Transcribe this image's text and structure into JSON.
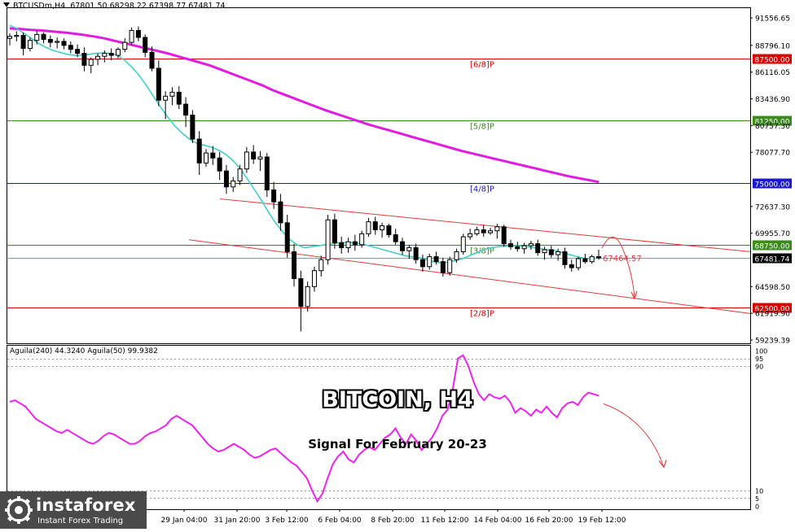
{
  "header": {
    "symbol": "BTCUSDm,H4",
    "ohlc": "67801.50 68298.22 67398.77 67481.74",
    "indicator": "Aguila(240) 44.3240  Aguila(50) 99.9382"
  },
  "overlay": {
    "title": "BITCOIN, H4",
    "subtitle": "Signal For February 20-23",
    "logo_brand": "instaforex",
    "logo_tagline": "Instant Forex Trading",
    "logo_icon": "gear-globe-icon"
  },
  "colors": {
    "candle": "#000000",
    "ma_fast": "#40d0c8",
    "ma_slow": "#e21be2",
    "murrey_red": "#dd0000",
    "murrey_green": "#3a8a1e",
    "murrey_blue": "#1a1acc",
    "channel": "#e33b3b",
    "oscillator": "#ee22ee",
    "price_line": "#7aa0a0"
  },
  "chart_data": [
    {
      "type": "line",
      "kind": "candlestick",
      "timeframe": "H4",
      "ylim": [
        59239.39,
        91556.65
      ],
      "y_ticks": [
        "91556.65",
        "88796.10",
        "86116.05",
        "83436.90",
        "80757.30",
        "78077.70",
        "75000.00",
        "72637.30",
        "69955.70",
        "68750.00",
        "67481.74",
        "64598.50",
        "61919.90",
        "59239.39"
      ],
      "x_ticks": [
        "29 Jan 04:00",
        "31 Jan 20:00",
        "3 Feb 12:00",
        "6 Feb 04:00",
        "8 Feb 20:00",
        "11 Feb 12:00",
        "14 Feb 04:00",
        "16 Feb 20:00",
        "19 Feb 12:00"
      ],
      "current_price": 67481.74,
      "target_label": "67464.57",
      "murrey_levels": [
        {
          "label": "[6/8]P",
          "price": 87500.0,
          "tag": "87500.00",
          "color": "#dd0000"
        },
        {
          "label": "[5/8]P",
          "price": 81250.0,
          "tag": "81250.00",
          "color": "#3a8a1e"
        },
        {
          "label": "[4/8]P",
          "price": 75000.0,
          "tag": "75000.00",
          "color": "#1a1acc"
        },
        {
          "label": "[3/8]P",
          "price": 68750.0,
          "tag": "68750.00",
          "color": "#3a8a1e"
        },
        {
          "label": "[2/8]P",
          "price": 62500.0,
          "tag": "62500.00",
          "color": "#dd0000"
        }
      ],
      "channel": {
        "upper": {
          "from": [
            0.0,
            73400
          ],
          "to": [
            1.0,
            68100
          ]
        },
        "lower": {
          "from": [
            -0.08,
            69300
          ],
          "to": [
            1.0,
            61900
          ]
        }
      },
      "ma_slow": [
        90500,
        90450,
        90350,
        90300,
        90200,
        90100,
        90000,
        89850,
        89700,
        89500,
        89250,
        89000,
        88750,
        88500,
        88250,
        88000,
        87700,
        87400,
        87100,
        86800,
        86400,
        86000,
        85600,
        85200,
        84800,
        84300,
        83900,
        83500,
        83100,
        82700,
        82300,
        81950,
        81600,
        81250,
        80900,
        80600,
        80300,
        80000,
        79700,
        79400,
        79100,
        78800,
        78500,
        78200,
        77950,
        77700,
        77450,
        77200,
        76950,
        76700,
        76450,
        76200,
        75950,
        75700,
        75500,
        75300,
        75100
      ],
      "ma_fast": [
        90800,
        90500,
        90000,
        89500,
        89000,
        88600,
        88300,
        88100,
        87900,
        87800,
        87800,
        87900,
        88000,
        88050,
        88000,
        87800,
        87300,
        86600,
        85800,
        84800,
        83700,
        82600,
        81600,
        80700,
        80000,
        79400,
        79000,
        78800,
        78600,
        78300,
        77900,
        77300,
        76500,
        75500,
        74400,
        73300,
        72100,
        71000,
        70100,
        69300,
        68800,
        68500,
        68600,
        68700,
        68800,
        68900,
        69000,
        69050,
        69000,
        68900,
        68700,
        68500,
        68300,
        68100,
        67900,
        67700,
        67600,
        67500,
        67300,
        67100,
        67000,
        67050,
        67200,
        67400,
        67700,
        68000,
        68300,
        68500,
        68600,
        68650,
        68700,
        68700,
        68600,
        68500,
        68400,
        68300,
        68200,
        68000,
        67800,
        67600,
        67450,
        67400,
        67480
      ],
      "candles": [
        [
          89500,
          90000,
          88800,
          89700
        ],
        [
          89700,
          90200,
          89200,
          89800
        ],
        [
          89800,
          90100,
          87800,
          88500
        ],
        [
          88500,
          89600,
          88200,
          89300
        ],
        [
          89300,
          90300,
          88900,
          89900
        ],
        [
          89900,
          90100,
          89000,
          89400
        ],
        [
          89400,
          89800,
          88600,
          89100
        ],
        [
          89100,
          89600,
          88500,
          89200
        ],
        [
          89200,
          89500,
          88400,
          88800
        ],
        [
          88800,
          89200,
          88000,
          88400
        ],
        [
          88400,
          88900,
          87600,
          88000
        ],
        [
          88000,
          88600,
          86200,
          86800
        ],
        [
          86800,
          87600,
          86000,
          87400
        ],
        [
          87400,
          88000,
          86800,
          87700
        ],
        [
          87700,
          88300,
          87100,
          88000
        ],
        [
          88000,
          88500,
          87300,
          87800
        ],
        [
          87800,
          88600,
          87500,
          88400
        ],
        [
          88400,
          89500,
          88100,
          89100
        ],
        [
          89100,
          90600,
          88800,
          90300
        ],
        [
          90300,
          90700,
          89200,
          89600
        ],
        [
          89600,
          89900,
          87600,
          88100
        ],
        [
          88100,
          88700,
          86200,
          86500
        ],
        [
          86500,
          87300,
          82700,
          83300
        ],
        [
          83300,
          84200,
          81400,
          83700
        ],
        [
          83700,
          84600,
          82800,
          84100
        ],
        [
          84100,
          84700,
          82400,
          82900
        ],
        [
          82900,
          83600,
          80600,
          81800
        ],
        [
          81800,
          82300,
          79000,
          79400
        ],
        [
          79400,
          80200,
          75800,
          77000
        ],
        [
          77000,
          78400,
          76600,
          78000
        ],
        [
          78000,
          78700,
          76800,
          77500
        ],
        [
          77500,
          78100,
          75300,
          76200
        ],
        [
          76200,
          76800,
          73900,
          74600
        ],
        [
          74600,
          75600,
          74100,
          75200
        ],
        [
          75200,
          76800,
          74800,
          76400
        ],
        [
          76400,
          78600,
          76000,
          78100
        ],
        [
          78100,
          78800,
          76900,
          77400
        ],
        [
          77400,
          78200,
          76200,
          77600
        ],
        [
          77600,
          78000,
          73600,
          74300
        ],
        [
          74300,
          75100,
          72400,
          73100
        ],
        [
          73100,
          73900,
          70200,
          71000
        ],
        [
          71000,
          71800,
          67500,
          68100
        ],
        [
          68100,
          68900,
          64600,
          65400
        ],
        [
          65400,
          66200,
          60100,
          62600
        ],
        [
          62600,
          65100,
          62100,
          64600
        ],
        [
          64600,
          66600,
          64100,
          66200
        ],
        [
          66200,
          67700,
          65600,
          67300
        ],
        [
          67300,
          71800,
          66800,
          71300
        ],
        [
          71300,
          71900,
          68400,
          69000
        ],
        [
          69000,
          69600,
          67900,
          68500
        ],
        [
          68500,
          69500,
          68000,
          69100
        ],
        [
          69100,
          69800,
          68200,
          68800
        ],
        [
          68800,
          70200,
          68500,
          69900
        ],
        [
          69900,
          71500,
          69600,
          71100
        ],
        [
          71100,
          71600,
          69800,
          70300
        ],
        [
          70300,
          71000,
          69500,
          70700
        ],
        [
          70700,
          70900,
          69500,
          69800
        ],
        [
          69800,
          70400,
          68800,
          69100
        ],
        [
          69100,
          69500,
          67800,
          68200
        ],
        [
          68200,
          68800,
          67400,
          68500
        ],
        [
          68500,
          68900,
          66900,
          67300
        ],
        [
          67300,
          67800,
          66100,
          66600
        ],
        [
          66600,
          67900,
          66300,
          67600
        ],
        [
          67600,
          68100,
          66800,
          67100
        ],
        [
          67100,
          67500,
          65600,
          66000
        ],
        [
          66000,
          67600,
          65700,
          67300
        ],
        [
          67300,
          68400,
          67000,
          68100
        ],
        [
          68100,
          69900,
          67800,
          69600
        ],
        [
          69600,
          70400,
          69300,
          69900
        ],
        [
          69900,
          70600,
          69700,
          70300
        ],
        [
          70300,
          70800,
          69600,
          70000
        ],
        [
          70000,
          70500,
          69800,
          70200
        ],
        [
          70200,
          70900,
          69400,
          70600
        ],
        [
          70600,
          70800,
          68600,
          68900
        ],
        [
          68900,
          69300,
          68300,
          68600
        ],
        [
          68600,
          69100,
          68100,
          68400
        ],
        [
          68400,
          69000,
          67900,
          68700
        ],
        [
          68700,
          69200,
          68300,
          68900
        ],
        [
          68900,
          69300,
          67700,
          68000
        ],
        [
          68000,
          68600,
          67300,
          68300
        ],
        [
          68300,
          68700,
          67500,
          67800
        ],
        [
          67800,
          68400,
          67200,
          68100
        ],
        [
          68100,
          68500,
          66400,
          66800
        ],
        [
          66800,
          67300,
          66100,
          66500
        ],
        [
          66500,
          67600,
          66200,
          67400
        ],
        [
          67400,
          67900,
          66900,
          67100
        ],
        [
          67100,
          67800,
          66900,
          67600
        ],
        [
          67600,
          68300,
          67300,
          67481
        ]
      ]
    },
    {
      "type": "line",
      "name": "Aguila",
      "ylim": [
        0,
        100
      ],
      "levels": [
        95,
        90,
        10,
        5
      ],
      "tick_labels": [
        "100",
        "95",
        "90",
        "10",
        "5",
        "0"
      ],
      "values": [
        67,
        68,
        66,
        64,
        60,
        56,
        54,
        52,
        50,
        48,
        47,
        49,
        47,
        45,
        43,
        41,
        40,
        42,
        45,
        47,
        46,
        44,
        42,
        40,
        40,
        42,
        45,
        47,
        48,
        50,
        52,
        56,
        58,
        56,
        54,
        52,
        48,
        44,
        40,
        37,
        35,
        36,
        38,
        40,
        38,
        36,
        33,
        31,
        32,
        34,
        36,
        37,
        34,
        31,
        28,
        26,
        22,
        18,
        10,
        3,
        8,
        18,
        27,
        32,
        35,
        30,
        28,
        33,
        36,
        38,
        36,
        40,
        44,
        46,
        50,
        44,
        40,
        46,
        42,
        36,
        40,
        44,
        50,
        58,
        62,
        75,
        95,
        97,
        90,
        80,
        72,
        68,
        72,
        70,
        69,
        71,
        67,
        60,
        63,
        61,
        58,
        62,
        60,
        64,
        60,
        57,
        63,
        66,
        67,
        65,
        70,
        73,
        72,
        71
      ]
    }
  ]
}
